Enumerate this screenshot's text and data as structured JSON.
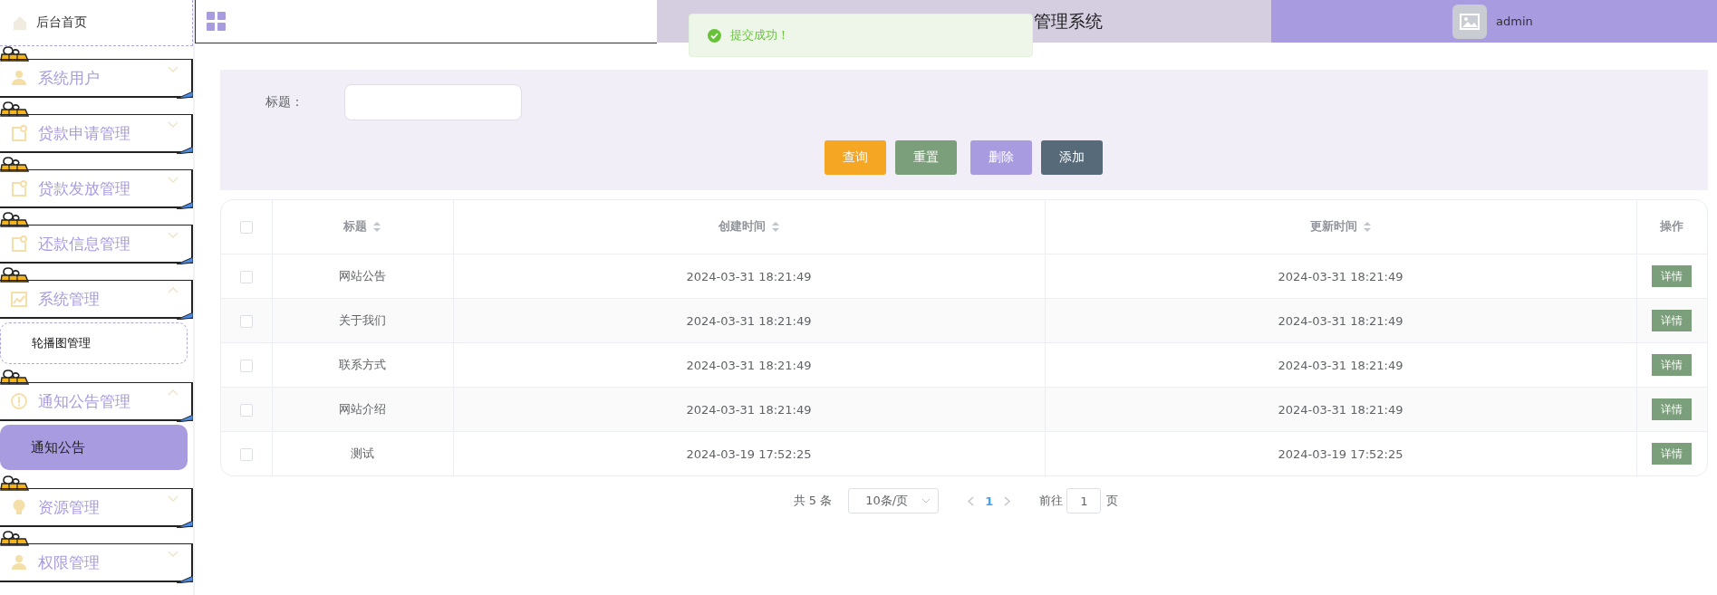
{
  "sidebar": {
    "home": {
      "label": "后台首页"
    },
    "menus": [
      {
        "label": "系统用户",
        "expanded": false
      },
      {
        "label": "贷款申请管理",
        "expanded": false
      },
      {
        "label": "贷款发放管理",
        "expanded": false
      },
      {
        "label": "还款信息管理",
        "expanded": false
      },
      {
        "label": "系统管理",
        "expanded": true,
        "children": [
          {
            "label": "轮播图管理",
            "selected": false
          }
        ]
      },
      {
        "label": "通知公告管理",
        "expanded": true,
        "children": [
          {
            "label": "通知公告",
            "selected": true
          }
        ]
      },
      {
        "label": "资源管理",
        "expanded": false
      },
      {
        "label": "权限管理",
        "expanded": false
      }
    ]
  },
  "header": {
    "title": "管理系统",
    "user": "admin"
  },
  "toast": {
    "message": "提交成功！"
  },
  "search": {
    "label": "标题：",
    "buttons": [
      {
        "label": "查询",
        "color": "#f5a623"
      },
      {
        "label": "重置",
        "color": "#7a9f7a"
      },
      {
        "label": "删除",
        "color": "#a99be0"
      },
      {
        "label": "添加",
        "color": "#566a7a"
      }
    ]
  },
  "table": {
    "select_all": {
      "checked": false
    },
    "columns": [
      {
        "label": "标题",
        "sortable": true
      },
      {
        "label": "创建时间",
        "sortable": true
      },
      {
        "label": "更新时间",
        "sortable": true
      },
      {
        "label": "操作",
        "sortable": false
      }
    ],
    "rows": [
      {
        "checked": false,
        "cells": [
          "网站公告",
          "2024-03-31 18:21:49",
          "2024-03-31 18:21:49"
        ],
        "action": "详情"
      },
      {
        "checked": false,
        "cells": [
          "关于我们",
          "2024-03-31 18:21:49",
          "2024-03-31 18:21:49"
        ],
        "action": "详情"
      },
      {
        "checked": false,
        "cells": [
          "联系方式",
          "2024-03-31 18:21:49",
          "2024-03-31 18:21:49"
        ],
        "action": "详情"
      },
      {
        "checked": false,
        "cells": [
          "网站介绍",
          "2024-03-31 18:21:49",
          "2024-03-31 18:21:49"
        ],
        "action": "详情"
      },
      {
        "checked": false,
        "cells": [
          "测试",
          "2024-03-19 17:52:25",
          "2024-03-19 17:52:25"
        ],
        "action": "详情"
      }
    ]
  },
  "pagination": {
    "total": "共 5 条",
    "page_size": "10条/页",
    "pages": [
      {
        "label": "1",
        "selected": true
      }
    ],
    "jump_label": "前往",
    "jump_value": "1",
    "jump_suffix": "页"
  }
}
